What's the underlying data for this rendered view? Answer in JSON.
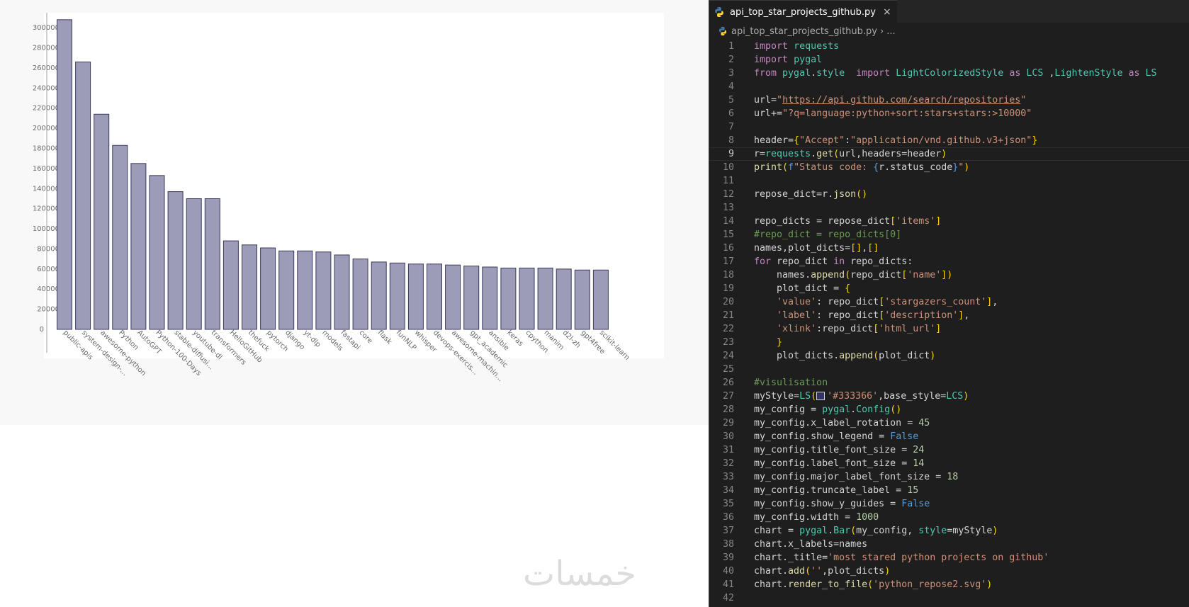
{
  "chart_data": {
    "type": "bar",
    "categories": [
      "public-apis",
      "system-design-...",
      "awesome-python",
      "Python",
      "AutoGPT",
      "Python-100-Days",
      "stable-diffusi...",
      "youtube-dl",
      "transformers",
      "HelloGitHub",
      "thefuck",
      "pytorch",
      "django",
      "yt-dlp",
      "models",
      "fastapi",
      "core",
      "flask",
      "funNLP",
      "whisper",
      "devops-exercis...",
      "awesome-machin...",
      "gpt_academic",
      "ansible",
      "keras",
      "cpython",
      "manim",
      "d2l-zh",
      "gpt4free",
      "scikit-learn"
    ],
    "values": [
      308000,
      266000,
      214000,
      183000,
      165000,
      153000,
      137000,
      130000,
      130000,
      88000,
      84000,
      81000,
      78000,
      78000,
      77000,
      74000,
      70000,
      67000,
      66000,
      65000,
      65000,
      64000,
      63000,
      62000,
      61000,
      61000,
      61000,
      60000,
      59000,
      59000
    ],
    "ylim": [
      0,
      310000
    ],
    "yticks": [
      "0",
      "20000",
      "40000",
      "60000",
      "80000",
      "100000",
      "120000",
      "140000",
      "160000",
      "180000",
      "200000",
      "220000",
      "240000",
      "260000",
      "280000",
      "300000"
    ],
    "ytick_values": [
      0,
      20000,
      40000,
      60000,
      80000,
      100000,
      120000,
      140000,
      160000,
      180000,
      200000,
      220000,
      240000,
      260000,
      280000,
      300000
    ],
    "bar_color": "#9c9cb8",
    "grid": false,
    "legend": false
  },
  "watermark": "خمسات",
  "editor": {
    "tab": {
      "title": "api_top_star_projects_github.py",
      "close": "×"
    },
    "breadcrumb": {
      "file": "api_top_star_projects_github.py",
      "sep": "›",
      "more": "..."
    },
    "active_line": 9,
    "lines": [
      "import requests",
      "import pygal",
      "from pygal.style  import LightColorizedStyle as LCS ,LightenStyle as LS",
      "",
      "url=\"https://api.github.com/search/repositories\"",
      "url+=\"?q=language:python+sort:stars+stars:>10000\"",
      "",
      "header={\"Accept\":\"application/vnd.github.v3+json\"}",
      "r=requests.get(url,headers=header)",
      "print(f\"Status code: {r.status_code}\")",
      "",
      "repose_dict=r.json()",
      "",
      "repo_dicts = repose_dict['items']",
      "#repo_dict = repo_dicts[0]",
      "names,plot_dicts=[],[]",
      "for repo_dict in repo_dicts:",
      "    names.append(repo_dict['name'])",
      "    plot_dict = {",
      "    'value': repo_dict['stargazers_count'],",
      "    'label': repo_dict['description'],",
      "    'xlink':repo_dict['html_url']",
      "    }",
      "    plot_dicts.append(plot_dict)",
      "",
      "#visulisation",
      "myStyle=LS('#333366',base_style=LCS)",
      "my_config = pygal.Config()",
      "my_config.x_label_rotation = 45",
      "my_config.show_legend = False",
      "my_config.title_font_size = 24",
      "my_config.label_font_size = 14",
      "my_config.major_label_font_size = 18",
      "my_config.truncate_label = 15",
      "my_config.show_y_guides = False",
      "my_config.width = 1000",
      "chart = pygal.Bar(my_config, style=myStyle)",
      "chart.x_labels=names",
      "chart._title='most stared python projects on github'",
      "chart.add('',plot_dicts)",
      "chart.render_to_file('python_repose2.svg')",
      ""
    ]
  }
}
